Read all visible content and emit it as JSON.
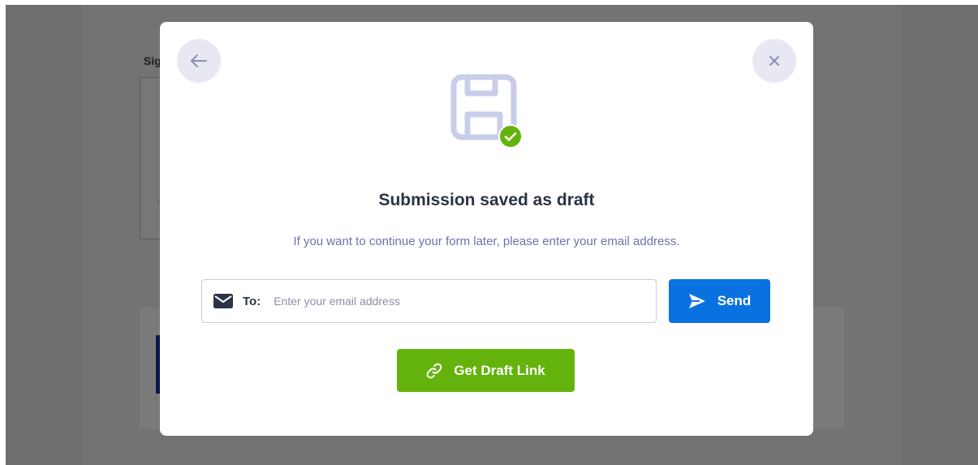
{
  "background": {
    "partial_label": "Sig"
  },
  "modal": {
    "title": "Submission saved as draft",
    "subtitle": "If you want to continue your form later, please enter your email address.",
    "icons": {
      "back": "arrow-left-icon",
      "close": "close-icon",
      "hero": "floppy-disk-icon",
      "check": "check-badge-icon"
    },
    "email": {
      "label": "To:",
      "placeholder": "Enter your email address",
      "value": "",
      "icon": "envelope-icon"
    },
    "send_button": {
      "label": "Send",
      "icon": "paper-plane-icon",
      "color": "#0a72e0"
    },
    "draft_link_button": {
      "label": "Get Draft Link",
      "icon": "link-icon",
      "color": "#64b20c"
    }
  },
  "colors": {
    "overlay": "#6e6e6e",
    "title_text": "#2c3345",
    "subtitle_text": "#6c73a8",
    "icon_tint": "#c8cde9",
    "check_green": "#64b20c"
  }
}
